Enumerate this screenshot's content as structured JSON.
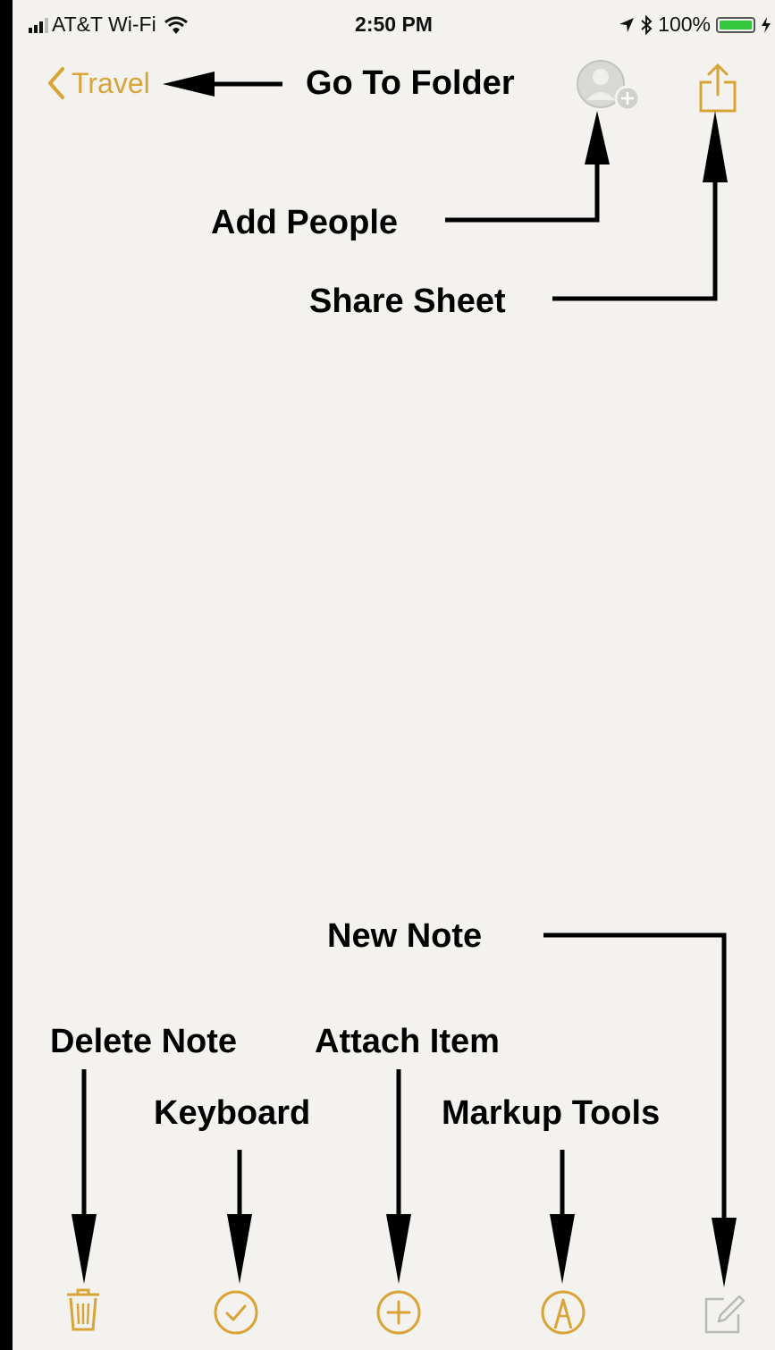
{
  "status_bar": {
    "carrier": "AT&T Wi-Fi",
    "time": "2:50 PM",
    "battery": "100%"
  },
  "nav": {
    "back_label": "Travel"
  },
  "annotations": {
    "go_to_folder": "Go To Folder",
    "add_people": "Add People",
    "share_sheet": "Share Sheet",
    "new_note": "New Note",
    "delete_note": "Delete Note",
    "attach_item": "Attach Item",
    "keyboard": "Keyboard",
    "markup_tools": "Markup Tools"
  },
  "toolbar": {
    "icons": [
      "trash-icon",
      "checkmark-circle-icon",
      "plus-circle-icon",
      "markup-pen-icon",
      "compose-icon"
    ]
  },
  "colors": {
    "accent": "#d9a437",
    "background": "#f3f2ef",
    "annotation": "#000000"
  }
}
